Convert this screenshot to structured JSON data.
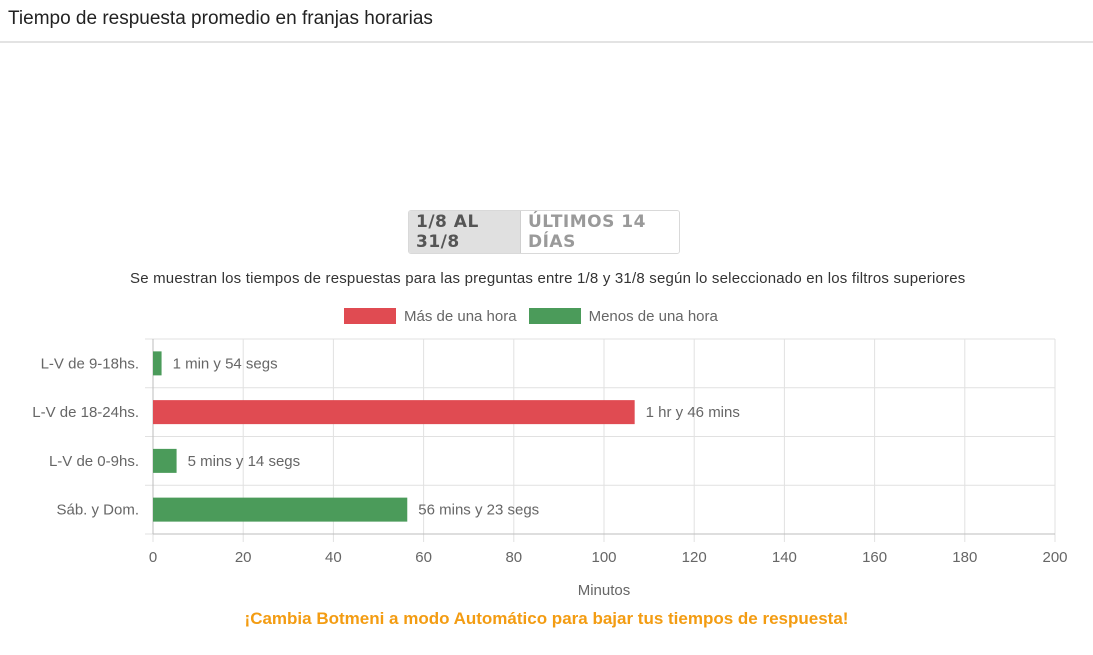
{
  "header": {
    "title": "Tiempo de respuesta promedio en franjas horarias"
  },
  "range_toggle": {
    "options": [
      "1/8 AL 31/8",
      "ÚLTIMOS 14 DÍAS"
    ],
    "selected": "1/8 AL 31/8"
  },
  "subtitle": "Se muestran los tiempos de respuestas para las preguntas entre 1/8 y 31/8 según lo seleccionado en los filtros superiores",
  "legend": [
    {
      "label": "Más de una hora",
      "color": "#e04b52"
    },
    {
      "label": "Menos de una hora",
      "color": "#4b9b5a"
    }
  ],
  "chart_data": {
    "type": "bar",
    "orientation": "horizontal",
    "categories": [
      "L-V de 9-18hs.",
      "L-V de 18-24hs.",
      "L-V de 0-9hs.",
      "Sáb. y Dom."
    ],
    "values": [
      1.9,
      106.8,
      5.23,
      56.38
    ],
    "value_labels": [
      "1 min y 54 segs",
      "1 hr y 46 mins",
      "5 mins y 14 segs",
      "56 mins y 23 segs"
    ],
    "bar_series": [
      "Menos de una hora",
      "Más de una hora",
      "Menos de una hora",
      "Menos de una hora"
    ],
    "xlabel": "Minutos",
    "xlim": [
      0,
      200
    ],
    "xticks": [
      0,
      20,
      40,
      60,
      80,
      100,
      120,
      140,
      160,
      180,
      200
    ],
    "grid": true,
    "legend_position": "top"
  },
  "cta": "¡Cambia Botmeni a modo Automático para bajar tus tiempos de respuesta!"
}
